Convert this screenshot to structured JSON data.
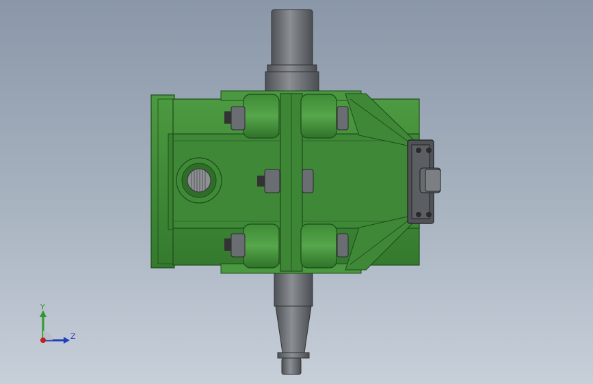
{
  "viewport": {
    "background_top": "#8a97a8",
    "background_bottom": "#c7cfd9"
  },
  "model": {
    "body_color": "#3f8a37",
    "body_dark": "#2c6a28",
    "shaft_color": "#6e7276",
    "hardware_color": "#55595d"
  },
  "triad": {
    "y_label": "Y",
    "z_label": "Z",
    "y_color": "#2e9a2e",
    "z_color": "#1f3fbf",
    "x_color": "#c02020"
  }
}
